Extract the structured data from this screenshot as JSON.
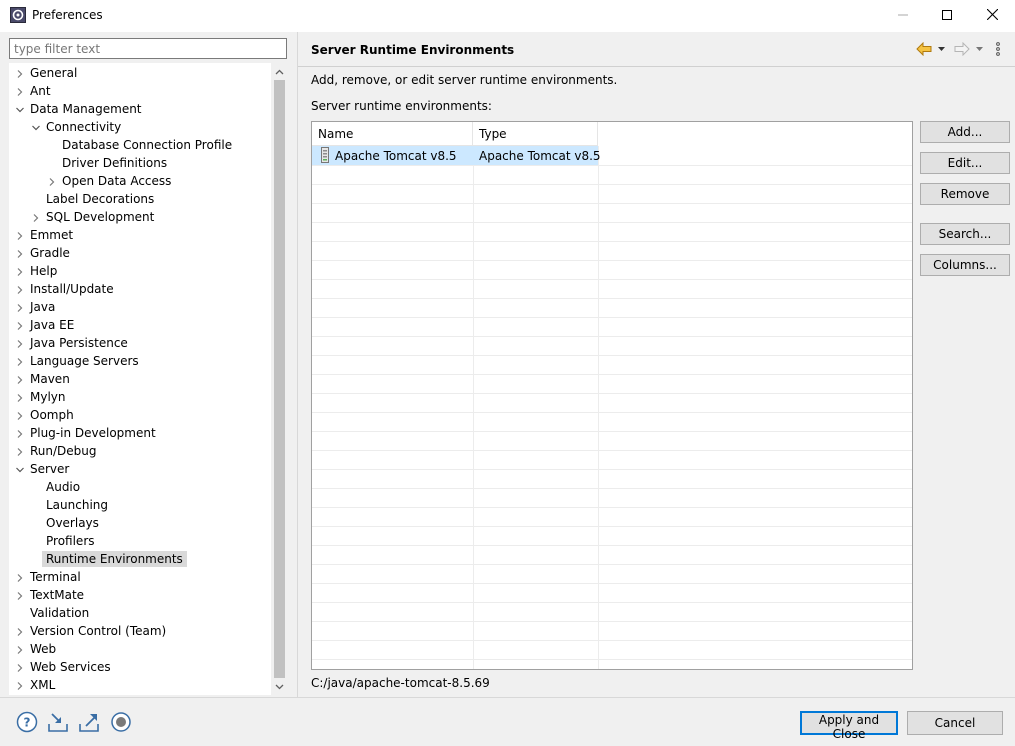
{
  "window": {
    "title": "Preferences",
    "icon": "eclipse-preferences-icon",
    "controls": [
      "minimize-icon",
      "maximize-icon",
      "close-icon"
    ]
  },
  "filter": {
    "placeholder": "type filter text",
    "value": ""
  },
  "tree": {
    "items": [
      {
        "label": "General",
        "level": 0,
        "expander": "collapsed"
      },
      {
        "label": "Ant",
        "level": 0,
        "expander": "collapsed"
      },
      {
        "label": "Data Management",
        "level": 0,
        "expander": "expanded"
      },
      {
        "label": "Connectivity",
        "level": 1,
        "expander": "expanded"
      },
      {
        "label": "Database Connection Profile",
        "level": 2,
        "expander": "none"
      },
      {
        "label": "Driver Definitions",
        "level": 2,
        "expander": "none"
      },
      {
        "label": "Open Data Access",
        "level": 2,
        "expander": "collapsed"
      },
      {
        "label": "Label Decorations",
        "level": 1,
        "expander": "none"
      },
      {
        "label": "SQL Development",
        "level": 1,
        "expander": "collapsed"
      },
      {
        "label": "Emmet",
        "level": 0,
        "expander": "collapsed"
      },
      {
        "label": "Gradle",
        "level": 0,
        "expander": "collapsed"
      },
      {
        "label": "Help",
        "level": 0,
        "expander": "collapsed"
      },
      {
        "label": "Install/Update",
        "level": 0,
        "expander": "collapsed"
      },
      {
        "label": "Java",
        "level": 0,
        "expander": "collapsed"
      },
      {
        "label": "Java EE",
        "level": 0,
        "expander": "collapsed"
      },
      {
        "label": "Java Persistence",
        "level": 0,
        "expander": "collapsed"
      },
      {
        "label": "Language Servers",
        "level": 0,
        "expander": "collapsed"
      },
      {
        "label": "Maven",
        "level": 0,
        "expander": "collapsed"
      },
      {
        "label": "Mylyn",
        "level": 0,
        "expander": "collapsed"
      },
      {
        "label": "Oomph",
        "level": 0,
        "expander": "collapsed"
      },
      {
        "label": "Plug-in Development",
        "level": 0,
        "expander": "collapsed"
      },
      {
        "label": "Run/Debug",
        "level": 0,
        "expander": "collapsed"
      },
      {
        "label": "Server",
        "level": 0,
        "expander": "expanded"
      },
      {
        "label": "Audio",
        "level": 1,
        "expander": "none"
      },
      {
        "label": "Launching",
        "level": 1,
        "expander": "none"
      },
      {
        "label": "Overlays",
        "level": 1,
        "expander": "none"
      },
      {
        "label": "Profilers",
        "level": 1,
        "expander": "none"
      },
      {
        "label": "Runtime Environments",
        "level": 1,
        "expander": "none",
        "selected": true
      },
      {
        "label": "Terminal",
        "level": 0,
        "expander": "collapsed"
      },
      {
        "label": "TextMate",
        "level": 0,
        "expander": "collapsed"
      },
      {
        "label": "Validation",
        "level": 0,
        "expander": "none"
      },
      {
        "label": "Version Control (Team)",
        "level": 0,
        "expander": "collapsed"
      },
      {
        "label": "Web",
        "level": 0,
        "expander": "collapsed"
      },
      {
        "label": "Web Services",
        "level": 0,
        "expander": "collapsed"
      },
      {
        "label": "XML",
        "level": 0,
        "expander": "collapsed"
      }
    ]
  },
  "page": {
    "title": "Server Runtime Environments",
    "description": "Add, remove, or edit server runtime environments.",
    "list_label": "Server runtime environments:",
    "nav_icons": [
      "back-arrow-icon",
      "back-menu-icon",
      "forward-arrow-icon",
      "forward-menu-icon",
      "view-menu-icon"
    ]
  },
  "table": {
    "columns": [
      "Name",
      "Type"
    ],
    "rows": [
      {
        "name": "Apache Tomcat v8.5",
        "type": "Apache Tomcat v8.5",
        "icon": "server-runtime-icon",
        "selected": true
      }
    ]
  },
  "buttons": {
    "add": "Add...",
    "edit": "Edit...",
    "remove": "Remove",
    "search": "Search...",
    "columns": "Columns..."
  },
  "location_path": "C:/java/apache-tomcat-8.5.69",
  "footer": {
    "icons": [
      "help-icon",
      "import-icon",
      "export-icon",
      "oomph-record-icon"
    ],
    "apply_close": "Apply and Close",
    "cancel": "Cancel"
  },
  "colors": {
    "selection": "#cce8ff",
    "tree_selection": "#d9d9d9",
    "default_button_border": "#0078d7",
    "nav_back": "#e8a317"
  }
}
